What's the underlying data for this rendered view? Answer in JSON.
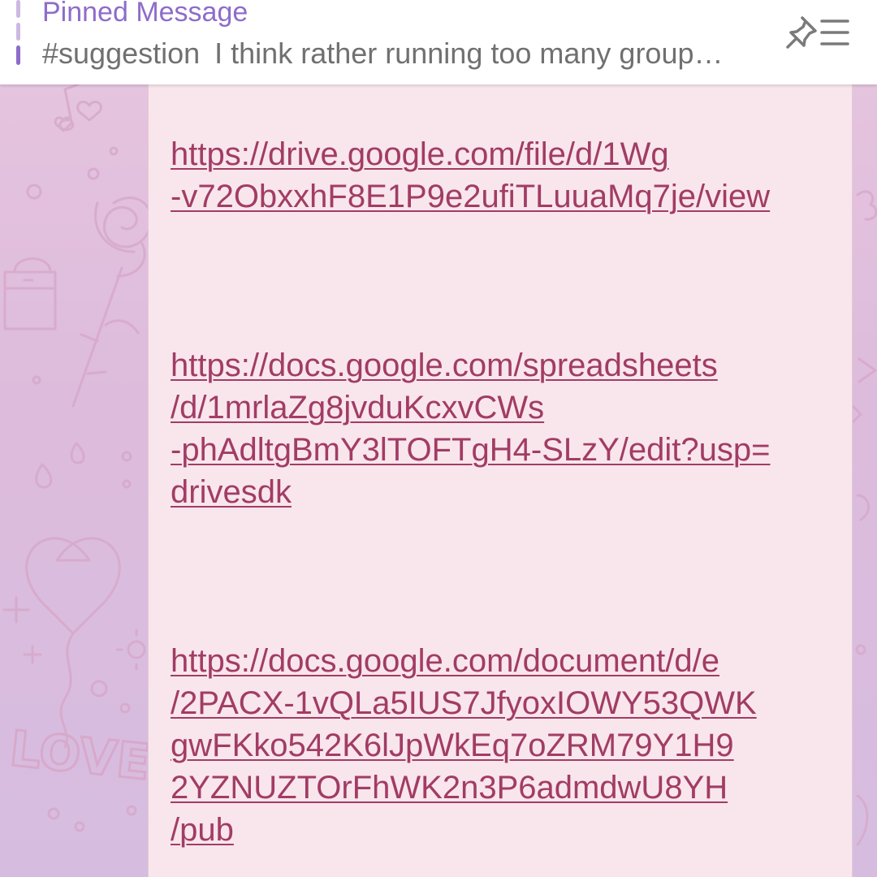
{
  "pinned": {
    "title": "Pinned Message",
    "hashtag": "#suggestion",
    "preview_text": "I think rather running too many group…",
    "count_indicator": {
      "total": 3,
      "active_index": 2
    },
    "list_icon": "pin-list-icon"
  },
  "message": {
    "links": [
      {
        "text": "https://drive.google.com/file/d/1Wg\n-v72ObxxhF8E1P9e2ufiTLuuaMq7je/view"
      },
      {
        "text": "https://docs.google.com/spreadsheets\n/d/1mrlaZg8jvduKcxvCWs\n-phAdltgBmY3lTOFTgH4-SLzY/edit?usp=\ndrivesdk"
      },
      {
        "text": "https://docs.google.com/document/d/e\n/2PACX-1vQLa5IUS7JfyoxIOWY53QWK\ngwFKko542K6lJpWkEq7oZRM79Y1H9\n2YZNUZTOrFhWK2n3P6admdwU8YH\n/pub"
      }
    ]
  },
  "wallpaper": {
    "doodle_text": "LOVE",
    "accent_color": "#a23c64",
    "pinned_accent": "#8e6cc9"
  }
}
